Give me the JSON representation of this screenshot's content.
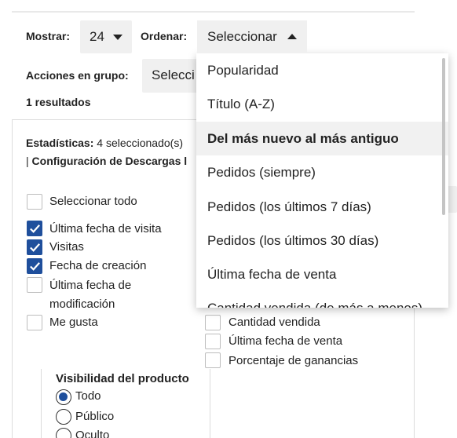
{
  "toolbar": {
    "show_label": "Mostrar:",
    "show_value": "24",
    "sort_label": "Ordenar:",
    "sort_value": "Seleccionar",
    "bulk_label": "Acciones en grupo:",
    "bulk_value": "Selecci",
    "results": "1 resultados"
  },
  "stats": {
    "label": "Estadísticas:",
    "value": "4 seleccionado(s)",
    "config_prefix": "|",
    "config_label": "Configuración de Descargas l"
  },
  "checkboxes_left": [
    {
      "label": "Seleccionar todo",
      "checked": false
    },
    {
      "label": "Última fecha de visita",
      "checked": true
    },
    {
      "label": "Visitas",
      "checked": true
    },
    {
      "label": "Fecha de creación",
      "checked": true
    },
    {
      "label": "Última fecha de",
      "label2": "modificación",
      "checked": false
    },
    {
      "label": "Me gusta",
      "checked": false
    }
  ],
  "checkboxes_right": [
    {
      "label": "Cantidad vendida",
      "checked": false
    },
    {
      "label": "Última fecha de venta",
      "checked": false
    },
    {
      "label": "Porcentaje de ganancias",
      "checked": false
    }
  ],
  "visibility": {
    "title": "Visibilidad del producto",
    "options": [
      {
        "label": "Todo",
        "selected": true
      },
      {
        "label": "Público",
        "selected": false
      },
      {
        "label": "Oculto",
        "selected": false
      }
    ]
  },
  "sort_dropdown": {
    "options": [
      {
        "label": "Popularidad"
      },
      {
        "label": "Título (A-Z)"
      },
      {
        "label": "Del más nuevo al más antiguo",
        "active": true
      },
      {
        "label": "Pedidos (siempre)"
      },
      {
        "label": "Pedidos (los últimos 7 días)"
      },
      {
        "label": "Pedidos (los últimos 30 días)"
      },
      {
        "label": "Última fecha de venta"
      },
      {
        "label": "Cantidad vendida (de más a menos)"
      }
    ]
  },
  "colors": {
    "accent": "#1f4f9c",
    "control_bg": "#f0f0f0"
  }
}
